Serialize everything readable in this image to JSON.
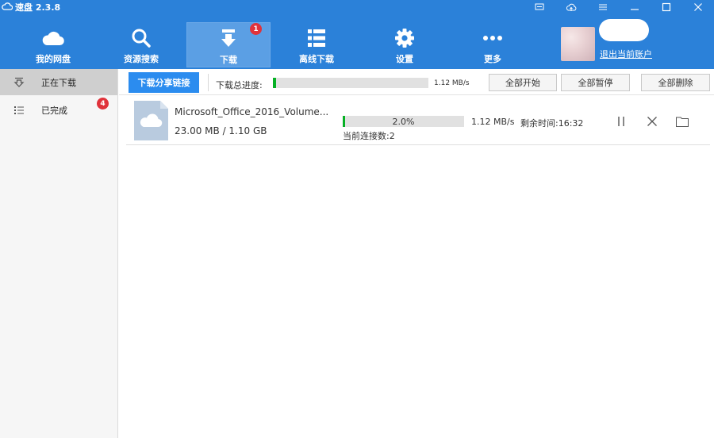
{
  "app": {
    "title": "速盘 2.3.8"
  },
  "window_controls": [
    {
      "name": "feedback-icon"
    },
    {
      "name": "upload-cloud-icon"
    },
    {
      "name": "menu-icon"
    },
    {
      "name": "minimize-icon"
    },
    {
      "name": "maximize-icon"
    },
    {
      "name": "close-icon"
    }
  ],
  "nav": {
    "items": [
      {
        "label": "我的网盘",
        "icon": "cloud-icon",
        "active": false
      },
      {
        "label": "资源搜索",
        "icon": "search-icon",
        "active": false
      },
      {
        "label": "下载",
        "icon": "download-icon",
        "active": true,
        "badge": "1"
      },
      {
        "label": "离线下载",
        "icon": "list-icon",
        "active": false
      },
      {
        "label": "设置",
        "icon": "gear-icon",
        "active": false
      },
      {
        "label": "更多",
        "icon": "more-icon",
        "active": false
      }
    ]
  },
  "account": {
    "logout_label": "退出当前账户"
  },
  "sidebar": {
    "items": [
      {
        "label": "正在下载",
        "icon": "downloading-icon",
        "active": true
      },
      {
        "label": "已完成",
        "icon": "completed-list-icon",
        "active": false,
        "badge": "4"
      }
    ]
  },
  "toolbar": {
    "share_button": "下载分享链接",
    "total_progress_label": "下载总进度:",
    "total_progress": 0.02,
    "total_speed": "1.12 MB/s",
    "start_all": "全部开始",
    "pause_all": "全部暂停",
    "delete_all": "全部删除"
  },
  "downloads": [
    {
      "file_name": "Microsoft_Office_2016_Volume...",
      "size": "23.00 MB / 1.10 GB",
      "progress": 0.02,
      "progress_text": "2.0%",
      "speed": "1.12 MB/s",
      "remaining": "剩余时间:16:32",
      "connections": "当前连接数:2"
    }
  ],
  "colors": {
    "accent": "#2b81d9",
    "nav_active": "#5b9fe4",
    "progress": "#06b025",
    "badge": "#e0323a",
    "share_button": "#2b8cef"
  }
}
